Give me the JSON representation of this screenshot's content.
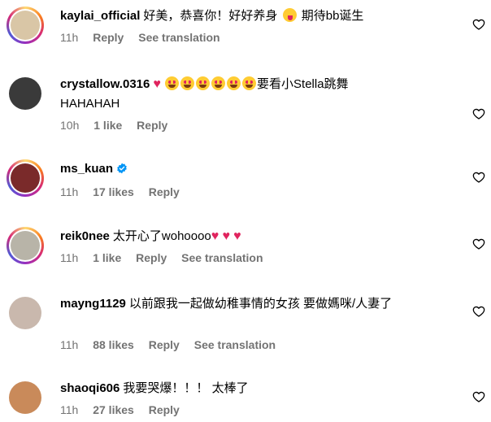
{
  "comments": [
    {
      "username": "kaylai_official",
      "text": "好美，恭喜你！好好养身",
      "text_after": "期待bb诞生",
      "time": "11h",
      "reply": "Reply",
      "see_translation": "See translation",
      "avatar_color": "#d9c6a6"
    },
    {
      "username": "crystallow.0316",
      "text": "要看小Stella跳舞",
      "text_line2": "HAHAHAH",
      "time": "10h",
      "likes": "1 like",
      "reply": "Reply",
      "avatar_color": "#3a3a3a"
    },
    {
      "username": "ms_kuan",
      "text": "",
      "time": "11h",
      "likes": "17 likes",
      "reply": "Reply",
      "avatar_color": "#7a2a2a"
    },
    {
      "username": "reik0nee",
      "text": "太开心了wohoooo",
      "time": "11h",
      "likes": "1 like",
      "reply": "Reply",
      "see_translation": "See translation",
      "avatar_color": "#b8b4a8"
    },
    {
      "username": "mayng1129",
      "text": "以前跟我一起做幼稚事情的女孩 要做媽咪/人妻了",
      "time": "11h",
      "likes": "88 likes",
      "reply": "Reply",
      "see_translation": "See translation",
      "avatar_color": "#c9b8ad"
    },
    {
      "username": "shaoqi606",
      "text": "我要哭爆！！！",
      "text_after": "太棒了",
      "time": "11h",
      "likes": "27 likes",
      "reply": "Reply",
      "avatar_color": "#c98a5a"
    }
  ],
  "colors": {
    "muted": "#737373",
    "heart": "#e0245e",
    "verified": "#0095f6"
  },
  "icons": {
    "like": "heart-outline-icon",
    "verified": "verified-badge-icon"
  }
}
